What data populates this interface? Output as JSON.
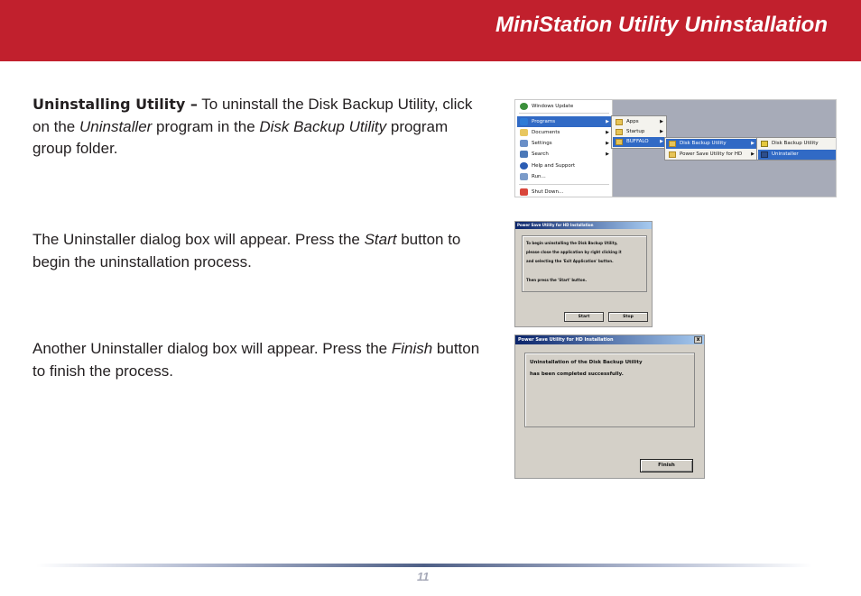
{
  "header": {
    "title": "MiniStation Utility Uninstallation",
    "bg_color": "#c1202d"
  },
  "sections": [
    {
      "lead": "Uninstalling Utility –",
      "t1": " To uninstall the Disk Backup Utility, click on the ",
      "em1": "Uninstaller",
      "t2": " program in the ",
      "em2": "Disk Backup Utility",
      "t3": " program group folder."
    },
    {
      "t1": "The Uninstaller dialog box will appear.  Press the ",
      "em1": "Start",
      "t2": " button to begin the uninstallation process."
    },
    {
      "t1": "Another Uninstaller dialog box will appear.  Press the ",
      "em1": "Finish",
      "t2": " button to finish the process."
    }
  ],
  "start_menu": {
    "items": [
      "Windows Update",
      "Programs",
      "Documents",
      "Settings",
      "Search",
      "Help and Support",
      "Run...",
      "Shut Down..."
    ],
    "programs_sub": [
      "Apps",
      "Startup",
      "BUFFALO"
    ],
    "buffalo_sub": [
      "Disk Backup Utility",
      "Power Save Utility for HD"
    ],
    "disk_backup_sub": [
      "Disk Backup Utility",
      "Uninstaller"
    ]
  },
  "dialog1": {
    "title": "Power Save Utility for HD Installation",
    "lines": [
      "To begin uninstalling the Disk Backup Utility,",
      "please close the application by right clicking it",
      "and selecting the 'Exit Application' button.",
      "Then press the 'Start' button."
    ],
    "start_label": "Start",
    "stop_label": "Stop"
  },
  "dialog2": {
    "title": "Power Save Utility for HD Installation",
    "close": "x",
    "lines": [
      "Uninstallation of the Disk Backup Utility",
      "has been completed successfully."
    ],
    "finish_label": "Finish"
  },
  "footer": {
    "page_number": "11"
  }
}
